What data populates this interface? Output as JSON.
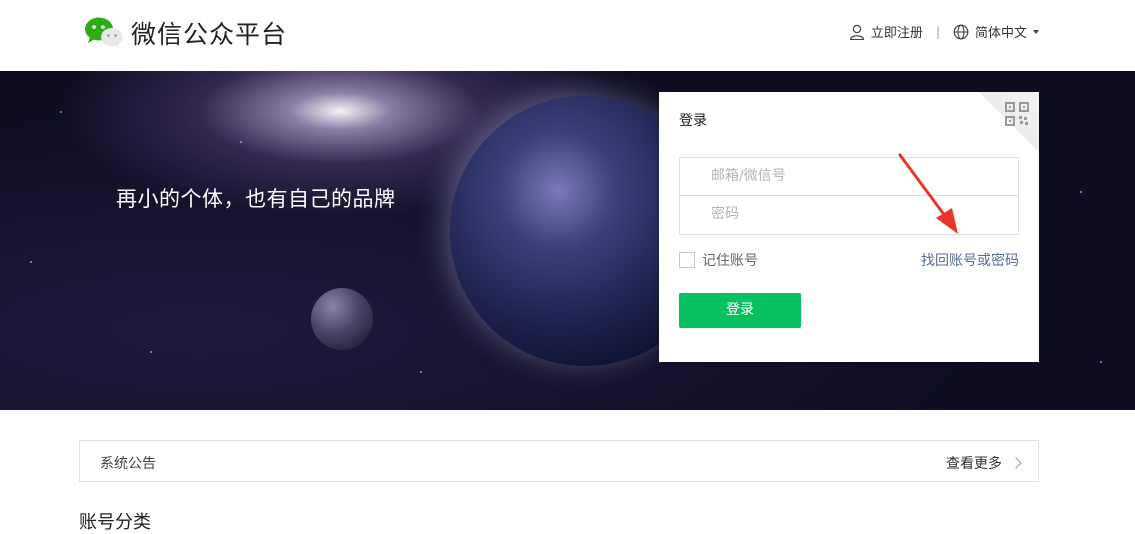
{
  "header": {
    "brand": "微信公众平台",
    "register_label": "立即注册",
    "separator": "|",
    "language_label": "简体中文"
  },
  "banner": {
    "slogan": "再小的个体，也有自己的品牌"
  },
  "login": {
    "title": "登录",
    "account_placeholder": "邮箱/微信号",
    "password_placeholder": "密码",
    "remember_label": "记住账号",
    "forgot_label": "找回账号或密码",
    "submit_label": "登录"
  },
  "notice": {
    "title": "系统公告",
    "more_label": "查看更多"
  },
  "section": {
    "title": "账号分类"
  },
  "colors": {
    "primary_green": "#07c160",
    "link_blue": "#576b95",
    "annotation_red": "#e8362a"
  }
}
